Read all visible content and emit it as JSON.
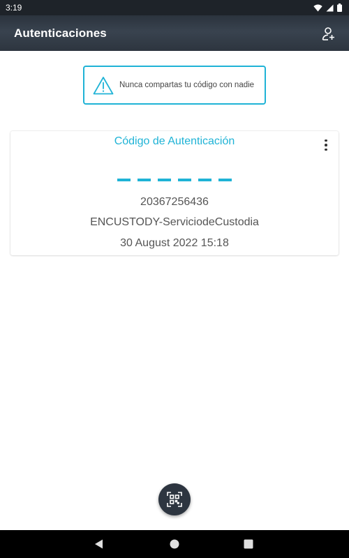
{
  "status_bar": {
    "time": "3:19",
    "icons": [
      "wifi-icon",
      "signal-icon",
      "battery-icon"
    ]
  },
  "app_bar": {
    "title": "Autenticaciones",
    "action_icon": "add-user-icon"
  },
  "warning": {
    "icon": "warning-triangle-icon",
    "text": "Nunca compartas tu código con nadie"
  },
  "auth_card": {
    "title": "Código de Autenticación",
    "code_placeholder_digits": 6,
    "id_number": "20367256436",
    "service": "ENCUSTODY-ServiciodeCustodia",
    "timestamp": "30 August 2022 15:18",
    "menu_icon": "more-vert-icon"
  },
  "fab": {
    "icon": "qr-scan-icon"
  },
  "nav_bar": {
    "buttons": [
      "back",
      "home",
      "recents"
    ]
  },
  "colors": {
    "accent": "#1fb3d6",
    "app_bar": "#333c47",
    "status_bar": "#1e2329",
    "fab": "#2d3540"
  }
}
